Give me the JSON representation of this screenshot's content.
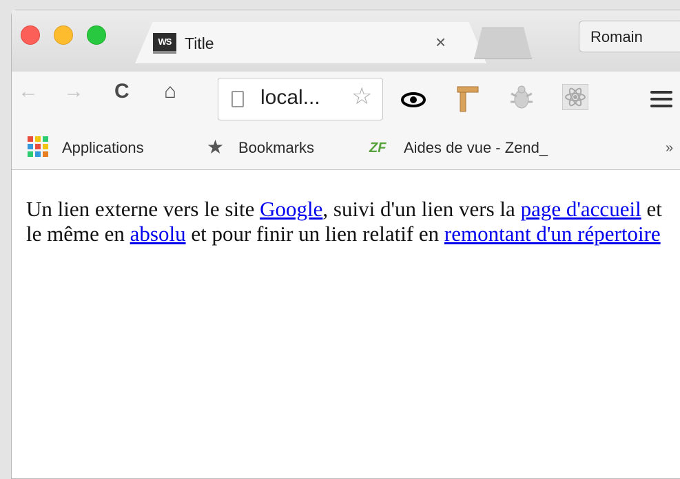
{
  "tab": {
    "title": "Title",
    "favicon_text": "WS",
    "close_label": "×"
  },
  "profile": {
    "name": "Romain"
  },
  "toolbar": {
    "url": "local...",
    "back_icon": "←",
    "forward_icon": "→",
    "reload_icon": "C",
    "home_icon": "⌂",
    "star_icon": "☆"
  },
  "bookmarks": {
    "items": [
      {
        "label": "Applications"
      },
      {
        "label": "Bookmarks"
      },
      {
        "label": "Aides de vue - Zend_"
      }
    ],
    "zf_icon_text": "ZF",
    "more_icon": "»"
  },
  "content": {
    "t1": "Un lien externe vers le site ",
    "link_google": "Google",
    "t2": ", suivi d'un lien vers la ",
    "link_home": "page d'accueil",
    "t3": " et le même en ",
    "link_absolute": "absolu",
    "t4": " et pour finir un lien relatif en ",
    "link_parent": "remontant d'un répertoire"
  },
  "colors": {
    "close": "#fc5f57",
    "minimize": "#fdbc2e",
    "maximize": "#28c940",
    "link": "#0000ee"
  }
}
